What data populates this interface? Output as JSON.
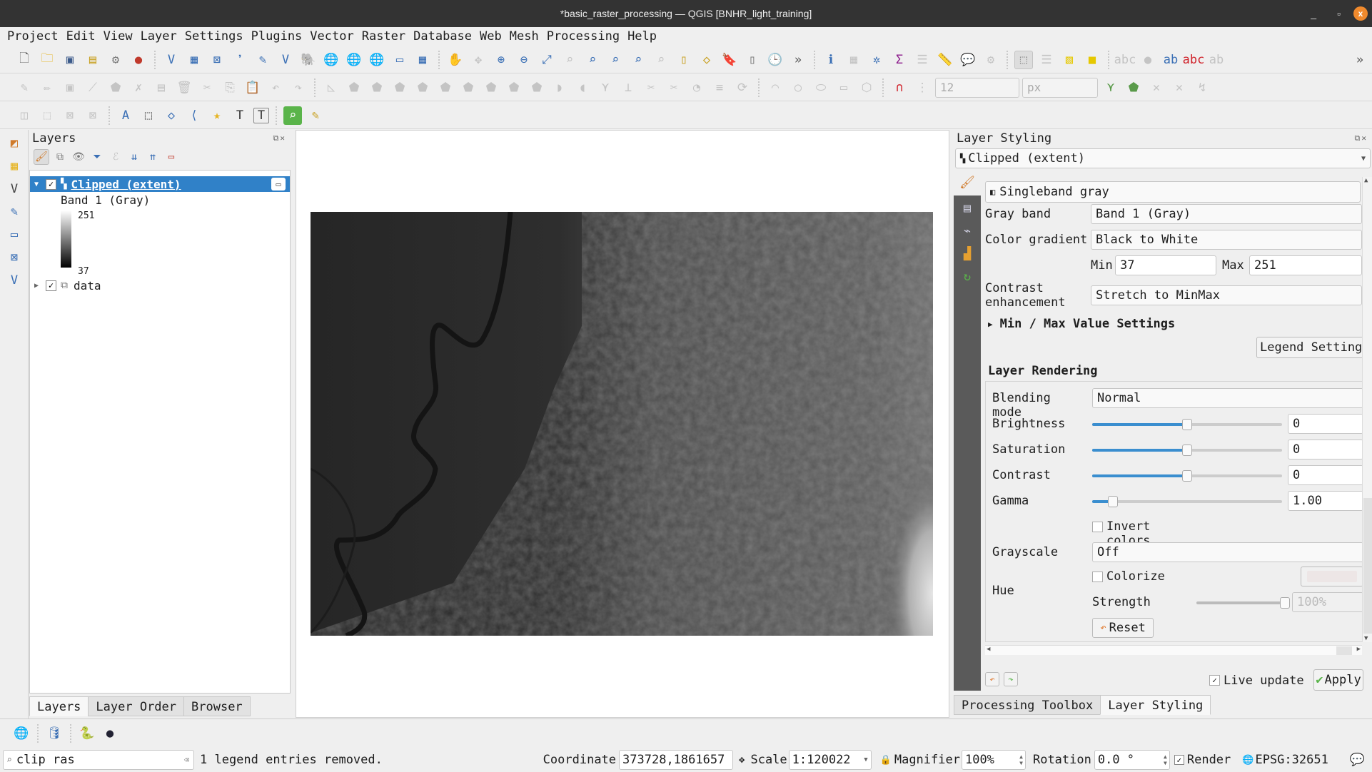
{
  "window": {
    "title": "*basic_raster_processing — QGIS [BNHR_light_training]",
    "controls": {
      "minimize": "_",
      "maximize": "▫",
      "close": "x"
    }
  },
  "menubar": [
    "Project",
    "Edit",
    "View",
    "Layer",
    "Settings",
    "Plugins",
    "Vector",
    "Raster",
    "Database",
    "Web",
    "Mesh",
    "Processing",
    "Help"
  ],
  "toolbar": {
    "snapping_tolerance": "12",
    "snapping_units": "px",
    "overflow": "»"
  },
  "layers_panel": {
    "title": "Layers",
    "layers": [
      {
        "name": "Clipped (extent)",
        "checked": true,
        "expanded": true,
        "selected": true,
        "legend": {
          "band": "Band 1 (Gray)",
          "max": "251",
          "min": "37"
        }
      },
      {
        "name": "data",
        "checked": true,
        "expanded": false,
        "selected": false,
        "type": "group"
      }
    ],
    "tabs": [
      "Layers",
      "Layer Order",
      "Browser"
    ],
    "active_tab": "Layers"
  },
  "layer_styling": {
    "title": "Layer Styling",
    "layer_select": "Clipped (extent)",
    "renderer": "Singleband gray",
    "gray_band_label": "Gray band",
    "gray_band": "Band 1 (Gray)",
    "color_gradient_label": "Color gradient",
    "color_gradient": "Black to White",
    "min_label": "Min",
    "min": "37",
    "max_label": "Max",
    "max": "251",
    "contrast_label_1": "Contrast",
    "contrast_label_2": "enhancement",
    "contrast_enhancement": "Stretch to MinMax",
    "minmax_section": "Min / Max Value Settings",
    "legend_settings": "Legend Settings",
    "rendering_section": "Layer Rendering",
    "blending_label": "Blending mode",
    "blending": "Normal",
    "brightness_label": "Brightness",
    "brightness": "0",
    "brightness_pos": 0.5,
    "saturation_label": "Saturation",
    "saturation": "0",
    "saturation_pos": 0.5,
    "contrast_label": "Contrast",
    "contrast": "0",
    "contrast_pos": 0.5,
    "gamma_label": "Gamma",
    "gamma": "1.00",
    "gamma_pos": 0.11,
    "invert_colors": "Invert colors",
    "grayscale_label": "Grayscale",
    "grayscale": "Off",
    "hue_label": "Hue",
    "colorize": "Colorize",
    "strength_label": "Strength",
    "strength": "100%",
    "strength_pos": 1.0,
    "reset": "Reset",
    "live_update": "Live update",
    "live_update_checked": true,
    "apply": "Apply"
  },
  "right_tabs": [
    "Processing Toolbox",
    "Layer Styling"
  ],
  "active_right_tab": "Layer Styling",
  "statusbar": {
    "search": "clip ras",
    "message": "1 legend entries removed.",
    "coordinate_label": "Coordinate",
    "coordinate": "373728,1861657",
    "scale_label": "Scale",
    "scale": "1:120022",
    "magnifier_label": "Magnifier",
    "magnifier": "100%",
    "rotation_label": "Rotation",
    "rotation": "0.0 °",
    "render_label": "Render",
    "render_checked": true,
    "crs": "EPSG:32651"
  }
}
